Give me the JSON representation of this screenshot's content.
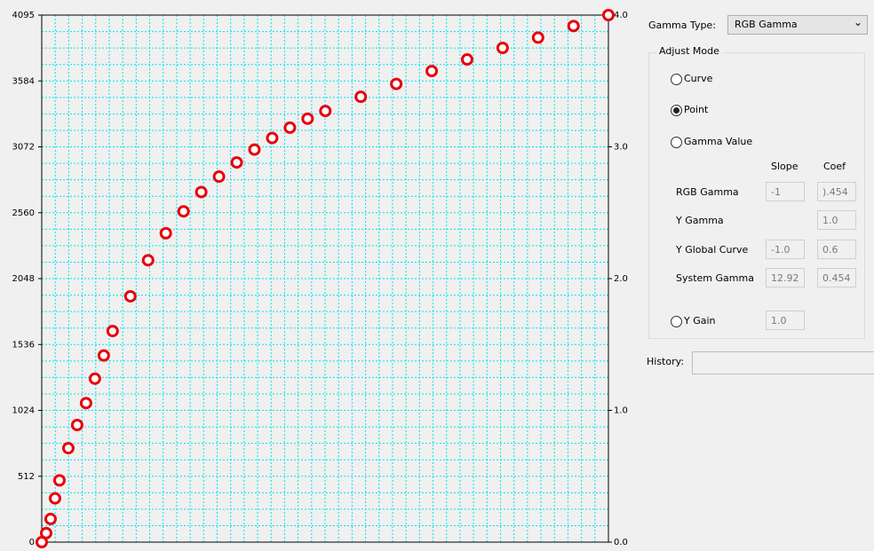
{
  "chart_data": {
    "type": "scatter",
    "left_axis_ticks": [
      "4095",
      "3584",
      "3072",
      "2560",
      "2048",
      "1536",
      "1024",
      "512",
      "0"
    ],
    "right_axis_ticks": [
      "4.0",
      "3.0",
      "2.0",
      "1.0",
      "0.0"
    ],
    "ylim": [
      0,
      4095
    ],
    "y2lim": [
      0,
      4.0
    ],
    "grid": true,
    "marker_color": "#e8000b",
    "grid_color": "#00e5ee",
    "points": [
      {
        "x": 0,
        "y": 0
      },
      {
        "x": 8,
        "y": 70
      },
      {
        "x": 16,
        "y": 180
      },
      {
        "x": 24,
        "y": 340
      },
      {
        "x": 32,
        "y": 480
      },
      {
        "x": 48,
        "y": 730
      },
      {
        "x": 64,
        "y": 910
      },
      {
        "x": 80,
        "y": 1080
      },
      {
        "x": 96,
        "y": 1270
      },
      {
        "x": 112,
        "y": 1450
      },
      {
        "x": 128,
        "y": 1640
      },
      {
        "x": 160,
        "y": 1910
      },
      {
        "x": 192,
        "y": 2190
      },
      {
        "x": 224,
        "y": 2400
      },
      {
        "x": 256,
        "y": 2570
      },
      {
        "x": 288,
        "y": 2720
      },
      {
        "x": 320,
        "y": 2840
      },
      {
        "x": 352,
        "y": 2950
      },
      {
        "x": 384,
        "y": 3050
      },
      {
        "x": 416,
        "y": 3140
      },
      {
        "x": 448,
        "y": 3220
      },
      {
        "x": 480,
        "y": 3290
      },
      {
        "x": 512,
        "y": 3350
      },
      {
        "x": 576,
        "y": 3460
      },
      {
        "x": 640,
        "y": 3560
      },
      {
        "x": 704,
        "y": 3660
      },
      {
        "x": 768,
        "y": 3750
      },
      {
        "x": 832,
        "y": 3840
      },
      {
        "x": 896,
        "y": 3920
      },
      {
        "x": 960,
        "y": 4010
      },
      {
        "x": 1023,
        "y": 4095
      }
    ],
    "xlim": [
      0,
      1023
    ]
  },
  "panel": {
    "gamma_type_label": "Gamma Type:",
    "gamma_type_value": "RGB Gamma",
    "chevron_glyph": "⌄",
    "adjust_mode_title": "Adjust Mode",
    "modes": {
      "curve": "Curve",
      "point": "Point",
      "gamma_value": "Gamma Value",
      "y_gain": "Y Gain"
    },
    "selected_mode": "point",
    "headers": {
      "slope": "Slope",
      "coef": "Coef"
    },
    "rows": {
      "rgb_gamma": {
        "label": "RGB Gamma",
        "slope": "-1",
        "coef": ").454"
      },
      "y_gamma": {
        "label": "Y Gamma",
        "coef": "1.0"
      },
      "y_global_curve": {
        "label": "Y Global Curve",
        "slope": "-1.0",
        "coef": "0.6"
      },
      "system_gamma": {
        "label": "System Gamma",
        "slope": "12.92",
        "coef": "0.454"
      }
    },
    "y_gain_value": "1.0",
    "history_label": "History:",
    "history_value": ""
  }
}
